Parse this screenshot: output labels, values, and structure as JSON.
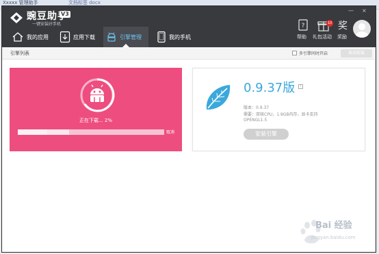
{
  "strip": {
    "left_text": "Xxxxx 管理助手",
    "right_text": "文档标签 docx"
  },
  "app": {
    "name": "豌豆助手",
    "version": "V3",
    "slogan": "一键安装好手机"
  },
  "nav": [
    {
      "label": "我的应用",
      "icon": "home-icon"
    },
    {
      "label": "应用下载",
      "icon": "download-icon"
    },
    {
      "label": "引擎管理",
      "icon": "android-icon"
    },
    {
      "label": "我的手机",
      "icon": "phone-icon"
    }
  ],
  "top_actions": [
    {
      "label": "帮助",
      "icon": "help-icon"
    },
    {
      "label": "礼包活动",
      "icon": "gift-icon",
      "badge": "10"
    },
    {
      "label": "奖励",
      "icon": "reward-icon"
    }
  ],
  "window_controls": {
    "min": "—",
    "close": "×"
  },
  "subbar": {
    "title": "引擎列表",
    "checkbox_label": "多引擎同时开启",
    "auto_button": "自动安装"
  },
  "download_card": {
    "status": "正在下载... 2%",
    "progress": 0.35,
    "progress_hi": 0.02,
    "cancel": "取消",
    "color": "#ee4d7f"
  },
  "engine_card": {
    "title": "0.9.37版",
    "version_line": "版本：0.9.37",
    "req_line": "需要：双核CPU，1.9GB内存，显卡支持",
    "gl_line": "OPENGL1.5",
    "install_button": "安装引擎",
    "accent": "#3aa8dc"
  },
  "watermark": {
    "text": "Bai 经验",
    "url": "jingyan.baidu.com"
  }
}
